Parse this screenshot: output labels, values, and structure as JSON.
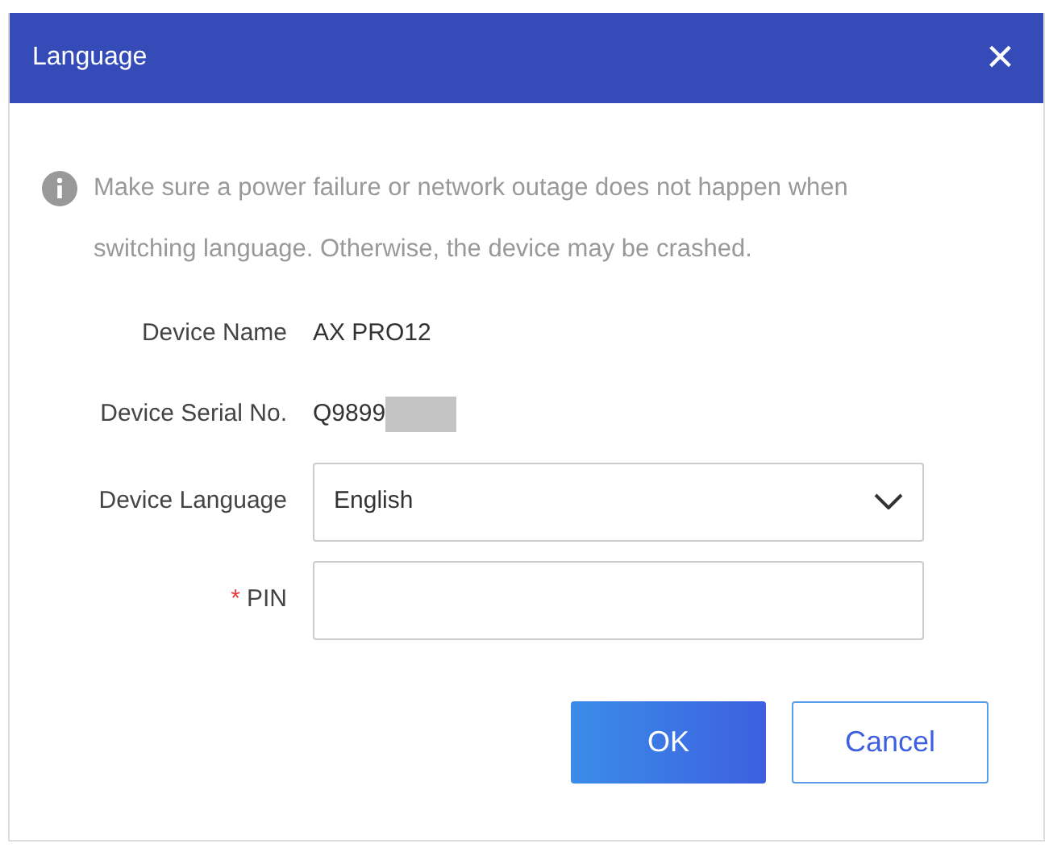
{
  "window": {
    "title": "Language",
    "close": "×"
  },
  "notice": "Make sure a power failure or network outage does not happen when switching language. Otherwise, the device may be crashed.",
  "fields": [
    {
      "kind": "text",
      "label": "Device Name",
      "value": "AX PRO12"
    },
    {
      "kind": "text",
      "label": "Device Serial No.",
      "value": "Q9899",
      "redacted": true
    },
    {
      "kind": "select",
      "label": "Device Language",
      "value": "English"
    },
    {
      "kind": "input",
      "label": "PIN",
      "required_mark": "*"
    }
  ],
  "buttons": [
    {
      "label": "OK",
      "kind": "primary"
    },
    {
      "label": "Cancel",
      "kind": "secondary"
    }
  ]
}
